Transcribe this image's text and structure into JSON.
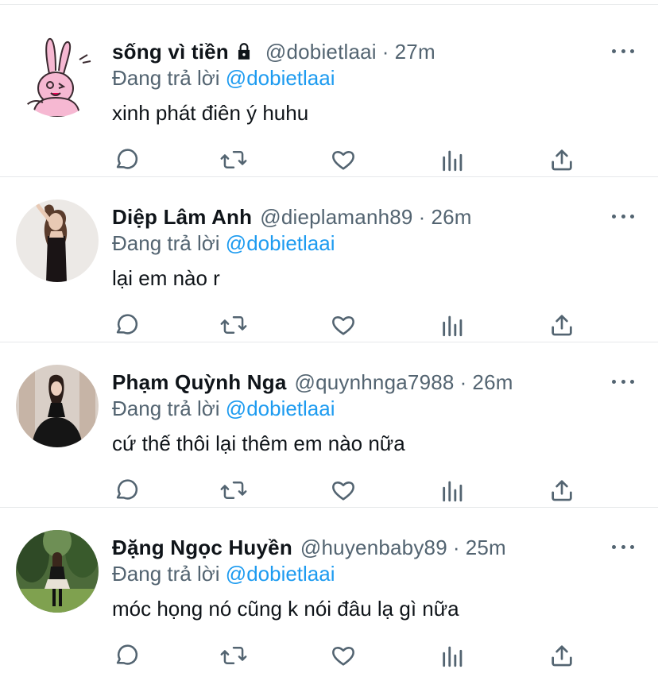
{
  "tweets": [
    {
      "name": "sống vì tiền",
      "locked": true,
      "handle": "@dobietlaai",
      "separator": "·",
      "time": "27m",
      "reply_prefix": "Đang trả lời",
      "reply_to": "@dobietlaai",
      "text": "xinh phát điên ý huhu",
      "avatar_icon": "pink-bunny-cartoon-avatar"
    },
    {
      "name": "Diệp Lâm Anh",
      "locked": false,
      "handle": "@dieplamanh89",
      "separator": "·",
      "time": "26m",
      "reply_prefix": "Đang trả lời",
      "reply_to": "@dobietlaai",
      "text": "lại em nào r",
      "avatar_icon": "woman-black-dress-photo"
    },
    {
      "name": "Phạm Quỳnh Nga",
      "locked": false,
      "handle": "@quynhnga7988",
      "separator": "·",
      "time": "26m",
      "reply_prefix": "Đang trả lời",
      "reply_to": "@dobietlaai",
      "text": "cứ thế thôi lại thêm em nào nữa",
      "avatar_icon": "woman-black-tulle-dress-photo"
    },
    {
      "name": "Đặng Ngọc Huyền",
      "locked": false,
      "handle": "@huyenbaby89",
      "separator": "·",
      "time": "25m",
      "reply_prefix": "Đang trả lời",
      "reply_to": "@dobietlaai",
      "text": "móc họng nó cũng k nói đâu lạ gì nữa",
      "avatar_icon": "woman-garden-photo"
    }
  ],
  "actions": [
    "reply-icon",
    "retweet-icon",
    "like-icon",
    "analytics-icon",
    "share-icon"
  ],
  "colors": {
    "text": "#0f1419",
    "secondary": "#536471",
    "link": "#1d9bf0",
    "divider": "#e6e8ea"
  }
}
